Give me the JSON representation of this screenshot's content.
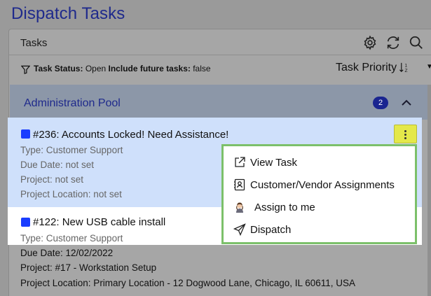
{
  "page": {
    "title": "Dispatch Tasks"
  },
  "tasks_panel": {
    "title": "Tasks",
    "icons": [
      "gear-icon",
      "refresh-icon",
      "search-icon"
    ],
    "filter": {
      "status_label": "Task Status:",
      "status_value": "Open",
      "future_label": "Include future tasks:",
      "future_value": "false"
    },
    "sort": {
      "label": "Task Priority",
      "icon": "sort-ascending-icon"
    }
  },
  "pool": {
    "name": "Administration Pool",
    "count": "2"
  },
  "tasks": [
    {
      "title": "#236:  Accounts Locked! Need Assistance!",
      "type": "Type: Customer Support",
      "due": "Due Date: not set",
      "project": "Project: not set",
      "location": "Project Location: not set"
    },
    {
      "title": "#122:  New USB cable install",
      "type": "Type: Customer Support",
      "due": "Due Date: 12/02/2022",
      "project": "Project: #17 - Workstation Setup",
      "location": "Project Location: Primary Location - 12 Dogwood Lane, Chicago, IL 60611, USA"
    }
  ],
  "context_menu": {
    "items": [
      {
        "label": "View Task",
        "icon": "external-link-icon"
      },
      {
        "label": "Customer/Vendor Assignments",
        "icon": "contact-card-icon"
      },
      {
        "label": "Assign to me",
        "icon": "user-avatar-icon"
      },
      {
        "label": "Dispatch",
        "icon": "send-icon"
      }
    ]
  },
  "colors": {
    "accent": "#1f2a8c",
    "selected_bg": "#cfe0fb",
    "menu_border": "#7cc06a",
    "kebab_highlight": "#e4e84a",
    "status_square": "#1a3dff"
  }
}
